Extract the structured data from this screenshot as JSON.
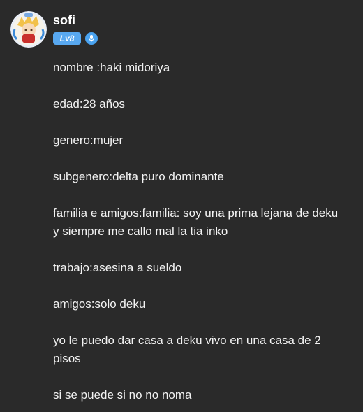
{
  "post": {
    "author": "sofi",
    "level_badge": "Lv8",
    "paragraphs": [
      "nombre :haki midoriya",
      "edad:28 años",
      "genero:mujer",
      "subgenero:delta puro dominante",
      "familia e amigos:familia: soy una prima lejana de deku y siempre me callo mal la tia inko",
      "trabajo:asesina a sueldo",
      "amigos:solo deku",
      "yo le puedo dar casa a deku vivo en una casa de 2 pisos",
      "si se puede si no no noma"
    ]
  },
  "icons": {
    "avatar": "avatar-icon",
    "verified": "verified-mic-icon"
  },
  "colors": {
    "background": "#2a2a2a",
    "text": "#f2f2f2",
    "level_badge": "#58a8f0",
    "verified_badge": "#4aa3f0"
  }
}
